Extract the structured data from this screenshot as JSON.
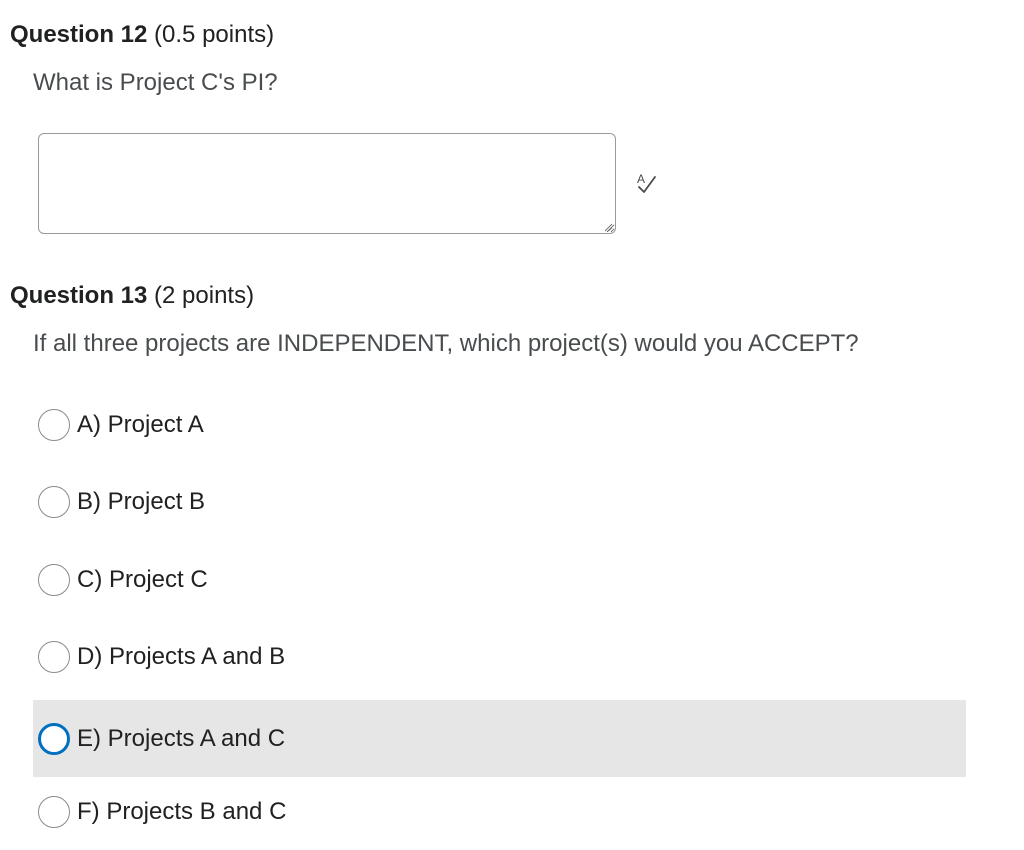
{
  "question12": {
    "title": "Question 12",
    "points": "(0.5 points)",
    "prompt": "What is Project C's PI?",
    "answer_value": "",
    "spellcheck_icon": "spellcheck-icon"
  },
  "question13": {
    "title": "Question 13",
    "points": "(2 points)",
    "prompt": "If all three projects are INDEPENDENT, which project(s) would you ACCEPT?",
    "options": [
      {
        "label": "A) Project A"
      },
      {
        "label": "B) Project B"
      },
      {
        "label": "C) Project C"
      },
      {
        "label": "D) Projects A and B"
      },
      {
        "label": "E) Projects A and C"
      },
      {
        "label": "F) Projects B and C"
      }
    ],
    "hovered_option": "E) Projects A and C"
  },
  "colors": {
    "text": "#202122",
    "prompt_text": "#494c4e",
    "hover_background": "#e6e6e6",
    "focus_ring": "#006fbf"
  }
}
